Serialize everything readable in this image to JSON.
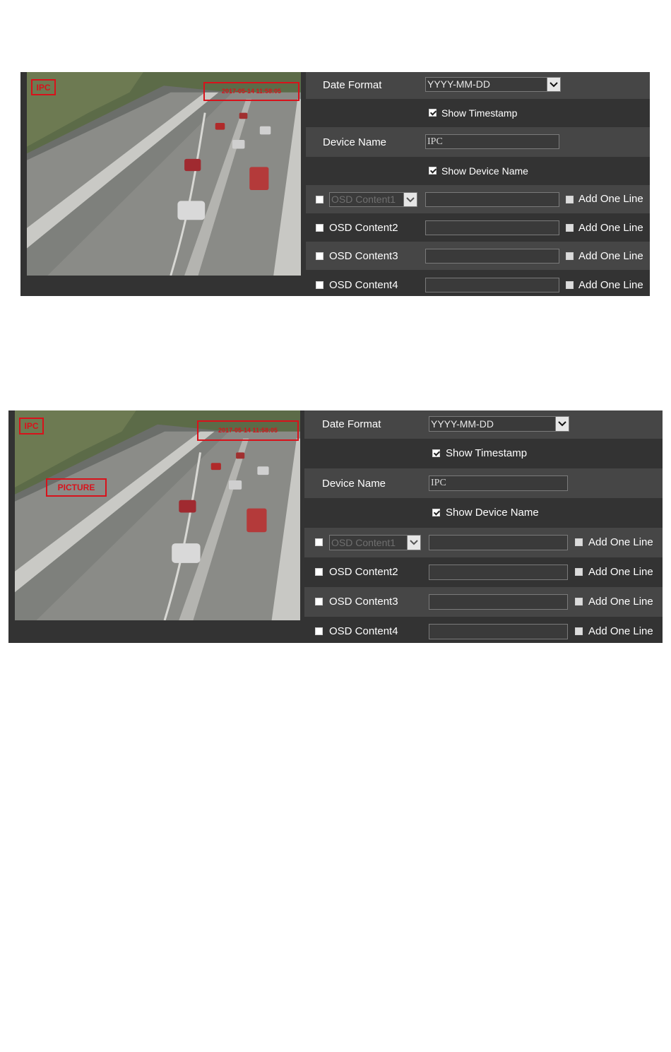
{
  "panels": [
    {
      "osd": {
        "device_name": "IPC",
        "timestamp": "2017-05-14 11:58:05",
        "picture": ""
      },
      "form": {
        "date_format_label": "Date Format",
        "date_format_value": "YYYY-MM-DD",
        "show_timestamp_label": "Show Timestamp",
        "show_timestamp_checked": true,
        "device_name_label": "Device Name",
        "device_name_value": "IPC",
        "show_device_name_label": "Show Device Name",
        "show_device_name_checked": true,
        "osd_content1_value": "OSD Content1",
        "osd_content2_label": "OSD Content2",
        "osd_content3_label": "OSD Content3",
        "osd_content4_label": "OSD Content4",
        "add_one_line_label": "Add One Line"
      }
    },
    {
      "osd": {
        "device_name": "IPC",
        "timestamp": "2017-05-14 11:58:05",
        "picture": "PICTURE"
      },
      "form": {
        "date_format_label": "Date Format",
        "date_format_value": "YYYY-MM-DD",
        "show_timestamp_label": "Show Timestamp",
        "show_timestamp_checked": true,
        "device_name_label": "Device Name",
        "device_name_value": "IPC",
        "show_device_name_label": "Show Device Name",
        "show_device_name_checked": true,
        "osd_content1_value": "OSD Content1",
        "osd_content2_label": "OSD Content2",
        "osd_content3_label": "OSD Content3",
        "osd_content4_label": "OSD Content4",
        "add_one_line_label": "Add One Line"
      }
    }
  ],
  "icons": {
    "dropdown": "chevron-down-icon",
    "checkbox": "checkbox-icon"
  },
  "colors": {
    "panel_bg": "#333333",
    "row_alt_bg": "#464646",
    "osd_box": "#d8121b"
  }
}
